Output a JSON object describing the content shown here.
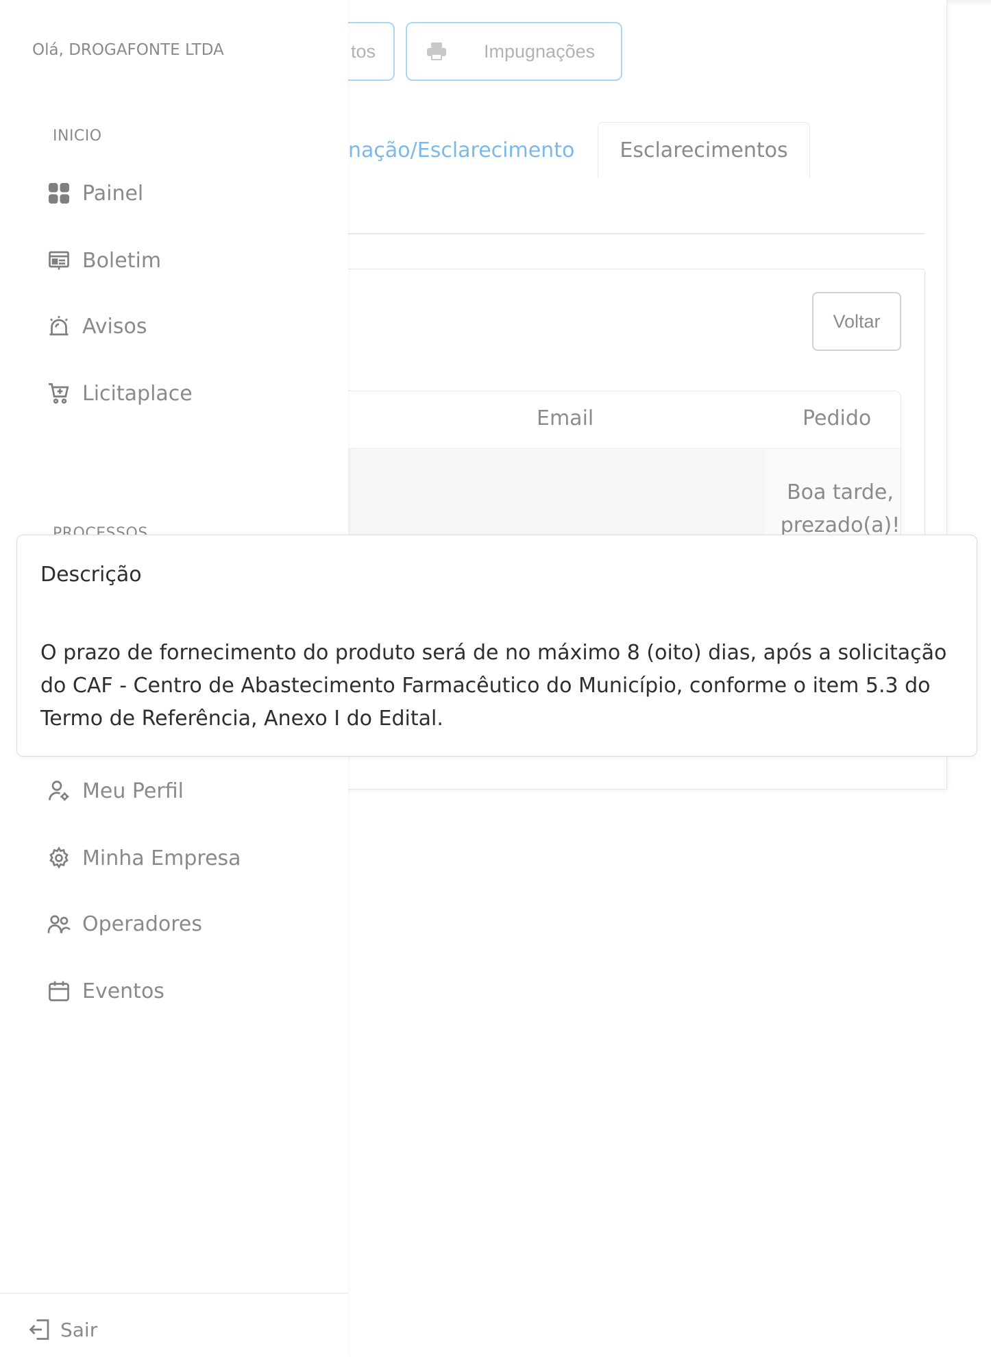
{
  "user": {
    "greeting": "Olá, DROGAFONTE LTDA"
  },
  "header_buttons": {
    "documentos_label": "tos",
    "impugnacoes_label": "Impugnações"
  },
  "tabs": {
    "impugnacao_label": "nação/Esclarecimento",
    "esclarecimentos_label": "Esclarecimentos"
  },
  "actions": {
    "voltar_label": "Voltar"
  },
  "table": {
    "columns": {
      "email": "Email",
      "pedido": "Pedido"
    },
    "row": {
      "pedido": "Boa tarde, prezado(a)!"
    }
  },
  "sidebar": {
    "sections": {
      "inicio": "INICIO",
      "processos": "PROCESSOS"
    },
    "inicio_items": [
      {
        "label": "Painel",
        "icon": "grid-icon"
      },
      {
        "label": "Boletim",
        "icon": "newspaper-icon"
      },
      {
        "label": "Avisos",
        "icon": "alarm-icon"
      },
      {
        "label": "Licitaplace",
        "icon": "cart-icon"
      }
    ],
    "account_items": [
      {
        "label": "Meu Perfil",
        "icon": "user-gear-icon"
      },
      {
        "label": "Minha Empresa",
        "icon": "gear-icon"
      },
      {
        "label": "Operadores",
        "icon": "users-icon"
      },
      {
        "label": "Eventos",
        "icon": "calendar-icon"
      }
    ],
    "logout_label": "Sair"
  },
  "description_popover": {
    "title": "Descrição",
    "text": "O prazo de fornecimento do produto será de no máximo 8 (oito) dias, após a solicitação do CAF - Centro de Abastecimento Farmacêutico do Município, conforme o item 5.3 do Termo de Referência, Anexo I do Edital."
  }
}
